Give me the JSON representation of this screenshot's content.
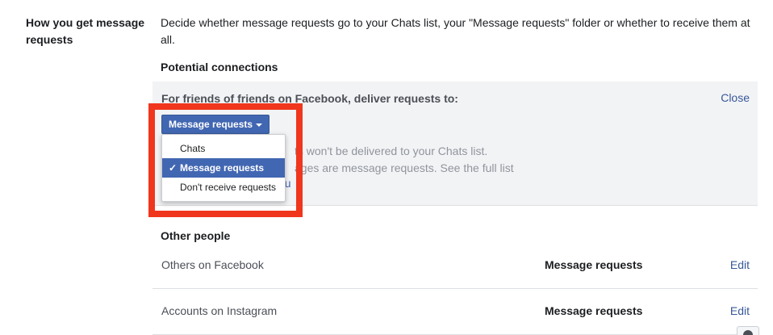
{
  "section": {
    "label": "How you get message requests",
    "description": "Decide whether message requests go to your Chats list, your \"Message requests\" folder or whether to receive them at all."
  },
  "potential": {
    "heading": "Potential connections",
    "panel_title": "For friends of friends on Facebook, deliver requests to:",
    "close_label": "Close",
    "hint_line1": "ts won't be delivered to your Chats list.",
    "hint_line2": "ages are message requests. See the full list",
    "hint_link": "ou",
    "dropdown": {
      "selected": "Message requests",
      "options": [
        "Chats",
        "Message requests",
        "Don't receive requests"
      ],
      "check": "✓"
    }
  },
  "other": {
    "heading": "Other people",
    "rows": [
      {
        "label": "Others on Facebook",
        "value": "Message requests",
        "action": "Edit"
      },
      {
        "label": "Accounts on Instagram",
        "value": "Message requests",
        "action": "Edit"
      }
    ]
  },
  "colors": {
    "accent": "#4267b2",
    "link": "#385898",
    "highlight": "#f0361d",
    "panel_bg": "#f2f3f5"
  },
  "icons": {
    "help": "help-icon",
    "caret": "caret-down-icon",
    "check": "checkmark-icon"
  }
}
